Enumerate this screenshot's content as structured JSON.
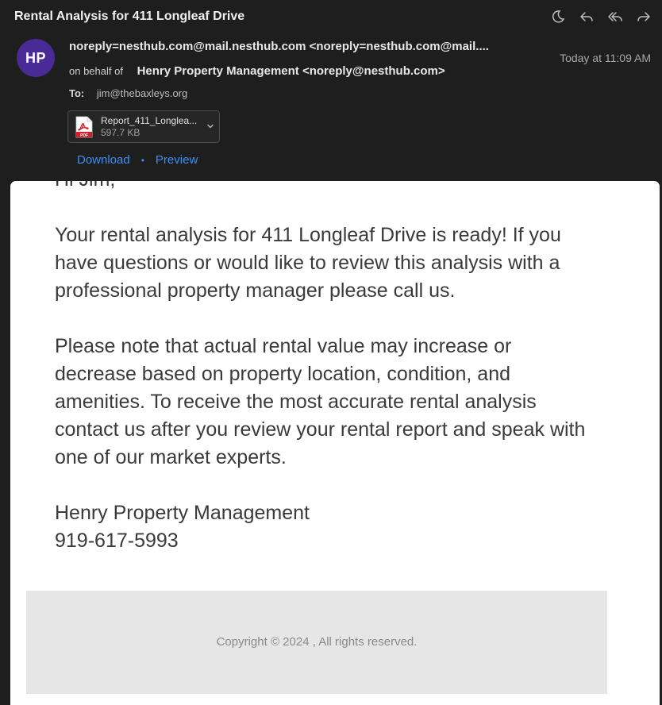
{
  "email": {
    "subject": "Rental Analysis for 411 Longleaf Drive",
    "avatar_initials": "HP",
    "avatar_color": "#4a2a96",
    "from": "noreply=nesthub.com@mail.nesthub.com <noreply=nesthub.com@mail....",
    "on_behalf_label": "on behalf of",
    "on_behalf_name": "Henry Property Management <noreply@nesthub.com>",
    "date": "Today at 11:09 AM",
    "to_label": "To:",
    "to_address": "jim@thebaxleys.org"
  },
  "toolbar": {
    "icons": [
      "moon-icon",
      "reply-icon",
      "reply-all-icon",
      "forward-icon"
    ]
  },
  "attachment": {
    "name": "Report_411_Longlea...",
    "size": "597.7 KB",
    "download_label": "Download",
    "separator": "•",
    "preview_label": "Preview",
    "link_color": "#3b8ff5"
  },
  "body": {
    "greeting": "Hi Jim,",
    "paragraph1": "Your rental analysis for 411 Longleaf Drive is ready! If you have questions or would like to review this analysis with a professional property manager please call us.",
    "paragraph2": "Please note that actual rental value may increase or decrease based on property location, condition, and amenities. To receive the most accurate rental analysis contact us after you review your rental report and speak with one of our market experts.",
    "signature_name": "Henry Property Management",
    "signature_phone": "919-617-5993"
  },
  "footer": {
    "copyright": "Copyright © 2024 , All rights reserved."
  }
}
